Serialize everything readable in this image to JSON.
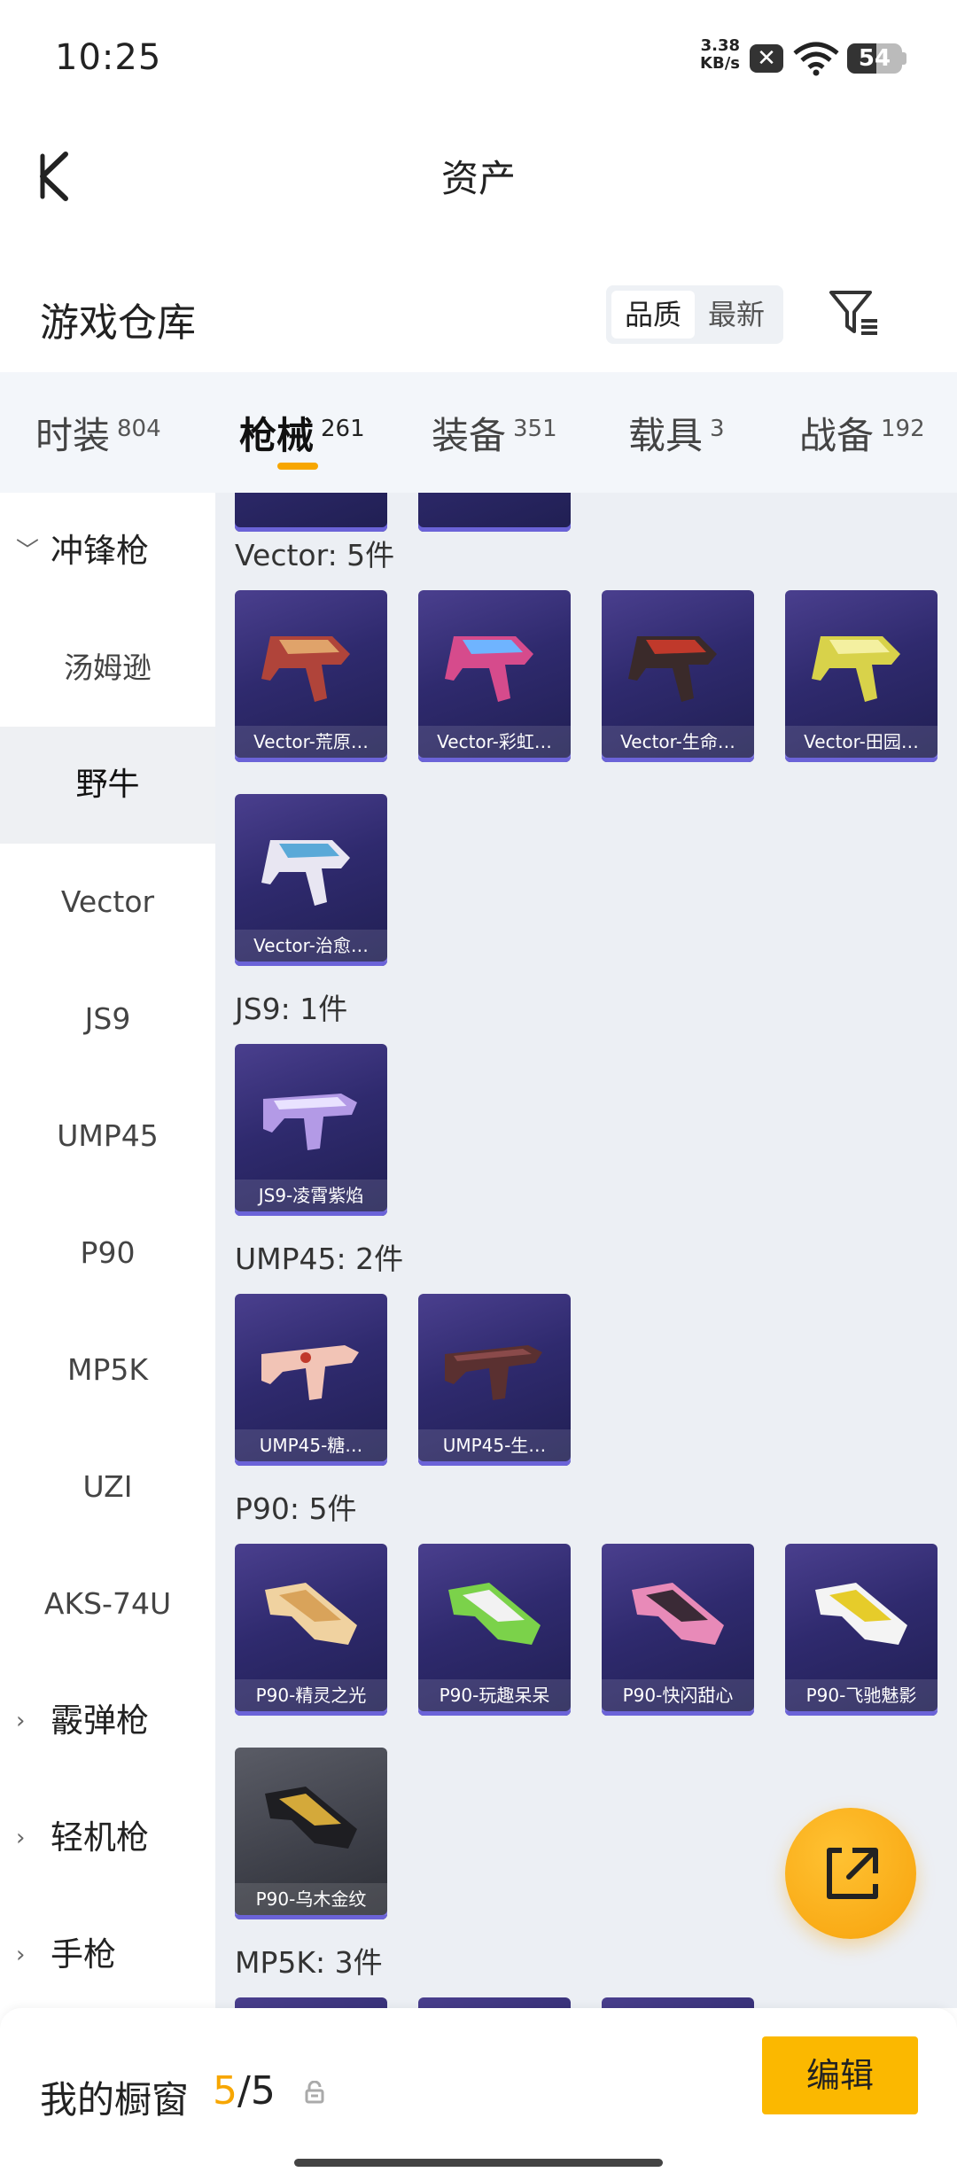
{
  "status_bar": {
    "time": "10:25",
    "net_speed_value": "3.38",
    "net_speed_unit": "KB/s",
    "battery": "54",
    "battery_level": 0.54
  },
  "header": {
    "title": "资产",
    "warehouse_title": "游戏仓库",
    "sort_options": [
      "品质",
      "最新"
    ],
    "sort_selected": "品质"
  },
  "tabs": [
    {
      "label": "时装",
      "count": "804"
    },
    {
      "label": "枪械",
      "count": "261",
      "active": true
    },
    {
      "label": "装备",
      "count": "351"
    },
    {
      "label": "载具",
      "count": "3"
    },
    {
      "label": "战备",
      "count": "192"
    }
  ],
  "sidebar": {
    "category_open": "冲锋枪",
    "items": [
      "汤姆逊",
      "野牛",
      "Vector",
      "JS9",
      "UMP45",
      "P90",
      "MP5K",
      "UZI",
      "AKS-74U"
    ],
    "selected": "野牛",
    "collapsed_categories": [
      "霰弹枪",
      "轻机枪",
      "手枪"
    ]
  },
  "groups": [
    {
      "title": "Vector: 5件",
      "items": [
        "Vector-荒原…",
        "Vector-彩虹…",
        "Vector-生命…",
        "Vector-田园…",
        "Vector-治愈…"
      ]
    },
    {
      "title": "JS9: 1件",
      "items": [
        "JS9-凌霄紫焰"
      ]
    },
    {
      "title": "UMP45: 2件",
      "items": [
        "UMP45-糖…",
        "UMP45-生…"
      ]
    },
    {
      "title": "P90: 5件",
      "items": [
        "P90-精灵之光",
        "P90-玩趣呆呆",
        "P90-快闪甜心",
        "P90-飞驰魅影",
        "P90-乌木金纹"
      ]
    },
    {
      "title": "MP5K: 3件",
      "items": []
    }
  ],
  "bottom_bar": {
    "label": "我的橱窗",
    "current": "5",
    "separator": "/",
    "total": "5",
    "edit_label": "编辑"
  },
  "colors": {
    "accent": "#f7a600",
    "card_bg": "#2f2a6e",
    "card_border": "#6b63d8",
    "edit_button": "#fbb800"
  }
}
